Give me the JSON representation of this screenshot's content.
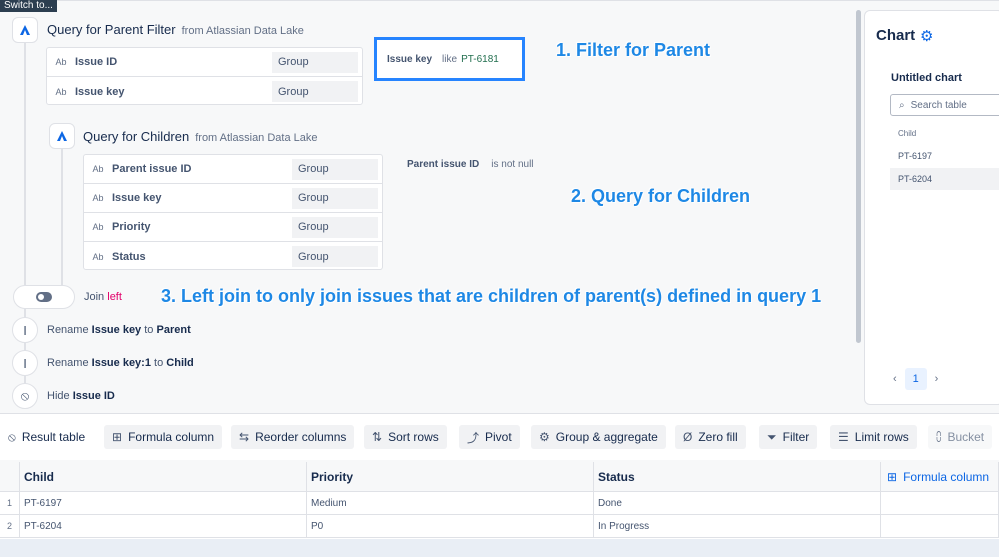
{
  "tooltip": "Switch to...",
  "query1": {
    "title": "Query for Parent Filter",
    "from": "from Atlassian Data Lake",
    "fields": [
      {
        "type": "Ab",
        "name": "Issue ID",
        "agg": "Group"
      },
      {
        "type": "Ab",
        "name": "Issue key",
        "agg": "Group"
      }
    ],
    "filter": {
      "field": "Issue key",
      "operator": "like",
      "value": "PT-6181"
    }
  },
  "query2": {
    "title": "Query for Children",
    "from": "from Atlassian Data Lake",
    "fields": [
      {
        "type": "Ab",
        "name": "Parent issue ID",
        "agg": "Group"
      },
      {
        "type": "Ab",
        "name": "Issue key",
        "agg": "Group"
      },
      {
        "type": "Ab",
        "name": "Priority",
        "agg": "Group"
      },
      {
        "type": "Ab",
        "name": "Status",
        "agg": "Group"
      }
    ],
    "filter": {
      "field": "Parent issue ID",
      "operator": "is not null"
    }
  },
  "annotations": {
    "a1": "1. Filter for Parent",
    "a2": "2. Query for Children",
    "a3": "3. Left join to only join issues that are children of parent(s) defined in query 1"
  },
  "join": {
    "label": "Join",
    "type": "left",
    "type_color": "#e2006a"
  },
  "steps": [
    {
      "prefix": "Rename",
      "field": "Issue key",
      "mid": "to",
      "target": "Parent",
      "icon": "text-cursor-icon"
    },
    {
      "prefix": "Rename",
      "field": "Issue key:1",
      "mid": "to",
      "target": "Child",
      "icon": "text-cursor-icon"
    },
    {
      "prefix": "Hide",
      "field": "Issue ID",
      "icon": "eye-off-icon"
    }
  ],
  "chart": {
    "title": "Chart",
    "subtitle": "Untitled chart",
    "search_placeholder": "Search table",
    "column": "Child",
    "rows": [
      "PT-6197",
      "PT-6204"
    ],
    "page": "1"
  },
  "toolbar": [
    {
      "label": "Result table",
      "icon": "eye-off-icon",
      "glyph": "⦸"
    },
    {
      "label": "Formula column",
      "icon": "formula-column-icon",
      "glyph": "⊞"
    },
    {
      "label": "Reorder columns",
      "icon": "reorder-icon",
      "glyph": "⇆"
    },
    {
      "label": "Sort rows",
      "icon": "sort-icon",
      "glyph": "⇅"
    },
    {
      "label": "Pivot",
      "icon": "pivot-icon",
      "glyph": "⤴"
    },
    {
      "label": "Group & aggregate",
      "icon": "group-icon",
      "glyph": "⚙"
    },
    {
      "label": "Zero fill",
      "icon": "zero-fill-icon",
      "glyph": "Ø"
    },
    {
      "label": "Filter",
      "icon": "filter-icon",
      "glyph": "⏷"
    },
    {
      "label": "Limit rows",
      "icon": "limit-rows-icon",
      "glyph": "☰"
    },
    {
      "label": "Bucket",
      "icon": "bucket-icon",
      "glyph": "⩇"
    }
  ],
  "table": {
    "columns": [
      "Child",
      "Priority",
      "Status",
      "Formula column"
    ],
    "rows": [
      {
        "n": "1",
        "child": "PT-6197",
        "priority": "Medium",
        "status": "Done"
      },
      {
        "n": "2",
        "child": "PT-6204",
        "priority": "P0",
        "status": "In Progress"
      }
    ]
  },
  "colors": {
    "accent": "#0c66e4",
    "annotation": "#1e88e5",
    "highlight": "#2684ff"
  }
}
